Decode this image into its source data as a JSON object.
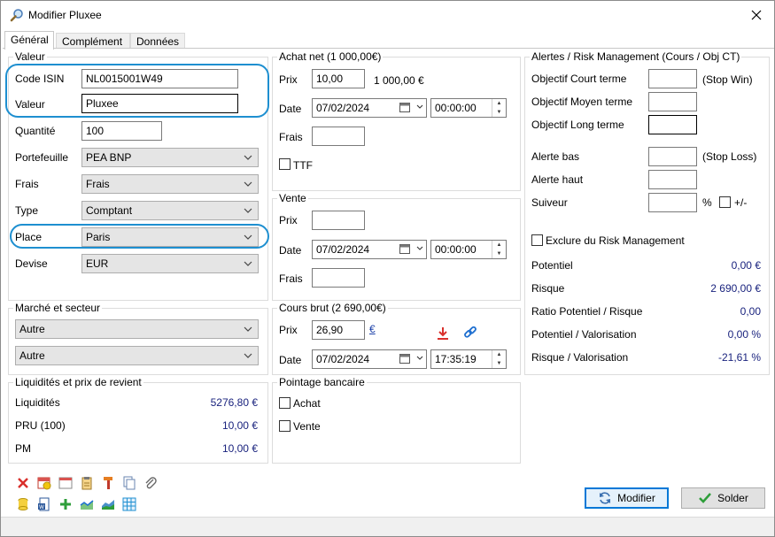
{
  "window": {
    "title": "Modifier Pluxee"
  },
  "tabs": [
    {
      "label": "Général"
    },
    {
      "label": "Complément"
    },
    {
      "label": "Données"
    }
  ],
  "valeur": {
    "group_title": "Valeur",
    "code_isin_label": "Code ISIN",
    "code_isin_value": "NL0015001W49",
    "valeur_label": "Valeur",
    "valeur_value": "Pluxee",
    "quantite_label": "Quantité",
    "quantite_value": "100",
    "portefeuille_label": "Portefeuille",
    "portefeuille_value": "PEA BNP",
    "frais_label": "Frais",
    "frais_value": "Frais",
    "type_label": "Type",
    "type_value": "Comptant",
    "place_label": "Place",
    "place_value": "Paris",
    "devise_label": "Devise",
    "devise_value": "EUR"
  },
  "marche": {
    "group_title": "Marché et secteur",
    "marche_value": "Autre",
    "secteur_value": "Autre"
  },
  "liquidites": {
    "group_title": "Liquidités et prix de revient",
    "liquidites_label": "Liquidités",
    "liquidites_value": "5276,80 €",
    "pru_label": "PRU (100)",
    "pru_value": "10,00 €",
    "pm_label": "PM",
    "pm_value": "10,00 €"
  },
  "achat": {
    "group_title": "Achat net (1 000,00€)",
    "prix_label": "Prix",
    "prix_value": "10,00",
    "total_value": "1 000,00 €",
    "date_label": "Date",
    "date_value": "07/02/2024",
    "time_value": "00:00:00",
    "frais_label": "Frais",
    "frais_value": "",
    "ttf_label": "TTF"
  },
  "vente": {
    "group_title": "Vente",
    "prix_label": "Prix",
    "prix_value": "",
    "date_label": "Date",
    "date_value": "07/02/2024",
    "time_value": "00:00:00",
    "frais_label": "Frais",
    "frais_value": ""
  },
  "cours": {
    "group_title": "Cours brut (2 690,00€)",
    "prix_label": "Prix",
    "prix_value": "26,90",
    "currency_symbol": "€",
    "date_label": "Date",
    "date_value": "07/02/2024",
    "time_value": "17:35:19"
  },
  "pointage": {
    "group_title": "Pointage bancaire",
    "achat_label": "Achat",
    "vente_label": "Vente"
  },
  "alertes": {
    "group_title": "Alertes / Risk Management (Cours / Obj CT)",
    "obj_court_label": "Objectif Court terme",
    "stop_win_label": "(Stop Win)",
    "obj_moyen_label": "Objectif Moyen terme",
    "obj_long_label": "Objectif Long terme",
    "alerte_bas_label": "Alerte bas",
    "stop_loss_label": "(Stop Loss)",
    "alerte_haut_label": "Alerte haut",
    "suiveur_label": "Suiveur",
    "percent_label": "%",
    "plusminus_label": "+/-",
    "exclure_label": "Exclure du Risk Management",
    "potentiel_label": "Potentiel",
    "potentiel_value": "0,00 €",
    "risque_label": "Risque",
    "risque_value": "2 690,00 €",
    "ratio_label": "Ratio Potentiel / Risque",
    "ratio_value": "0,00",
    "pot_val_label": "Potentiel / Valorisation",
    "pot_val_value": "0,00 %",
    "risque_val_label": "Risque / Valorisation",
    "risque_val_value": "-21,61 %"
  },
  "buttons": {
    "modifier_label": "Modifier",
    "solder_label": "Solder"
  },
  "colors": {
    "accent": "#1e8fd0",
    "value_text": "#1a237e",
    "delete_red": "#d9302c",
    "add_green": "#2e9e3a"
  }
}
